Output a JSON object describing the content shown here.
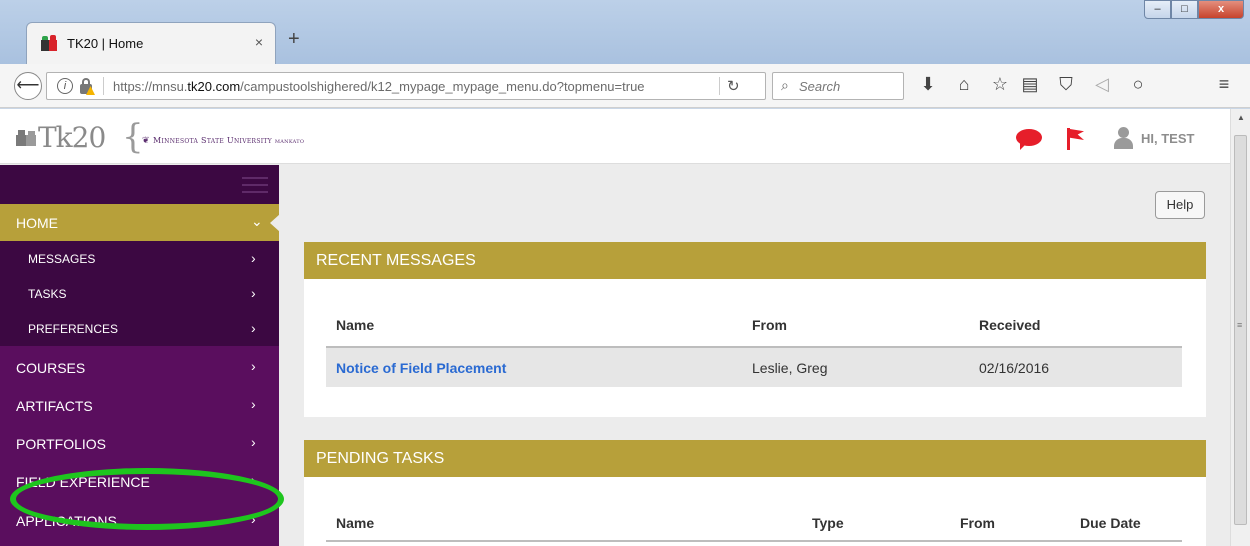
{
  "browser": {
    "tab_title": "TK20 | Home",
    "tab_close": "×",
    "new_tab": "+",
    "url_host": "https://mnsu.",
    "url_domain": "tk20.com",
    "url_path": "/campustoolshighered/k12_mypage_mypage_menu.do?topmenu=true",
    "search_placeholder": "Search",
    "window_controls": {
      "minimize": "–",
      "maximize": "□",
      "close": "x"
    }
  },
  "header": {
    "logo_text": "Tk20",
    "logo_brace": "{",
    "university_name": "Minnesota State University Mankato",
    "greeting": "HI, TEST"
  },
  "sidebar": {
    "items": [
      {
        "label": "HOME",
        "chevron": "⌄",
        "active": true
      },
      {
        "label": "MESSAGES",
        "chevron": "›"
      },
      {
        "label": "TASKS",
        "chevron": "›"
      },
      {
        "label": "PREFERENCES",
        "chevron": "›"
      },
      {
        "label": "COURSES",
        "chevron": "›"
      },
      {
        "label": "ARTIFACTS",
        "chevron": "›"
      },
      {
        "label": "PORTFOLIOS",
        "chevron": "›"
      },
      {
        "label": "FIELD EXPERIENCE",
        "chevron": "›"
      },
      {
        "label": "APPLICATIONS",
        "chevron": "›"
      }
    ]
  },
  "main": {
    "help_label": "Help",
    "recent_messages": {
      "title": "RECENT MESSAGES",
      "columns": [
        "Name",
        "From",
        "Received"
      ],
      "rows": [
        {
          "name": "Notice of Field Placement",
          "from": "Leslie, Greg",
          "received": "02/16/2016"
        }
      ]
    },
    "pending_tasks": {
      "title": "PENDING TASKS",
      "columns": [
        "Name",
        "Type",
        "From",
        "Due Date"
      ]
    }
  },
  "colors": {
    "sidebar": "#5a0e5e",
    "sidebar_dark": "#3c0842",
    "gold": "#b7a03a",
    "link": "#2a6ad2",
    "highlight": "#1ec51e",
    "alert_red": "#e61e2a"
  },
  "icons": {
    "header": [
      "chat-bubble-icon",
      "flag-icon",
      "user-icon"
    ],
    "toolbar": [
      "download-icon",
      "home-icon",
      "bookmark-star-icon",
      "reading-list-icon",
      "pocket-icon",
      "share-icon",
      "chat-icon",
      "menu-icon"
    ]
  }
}
